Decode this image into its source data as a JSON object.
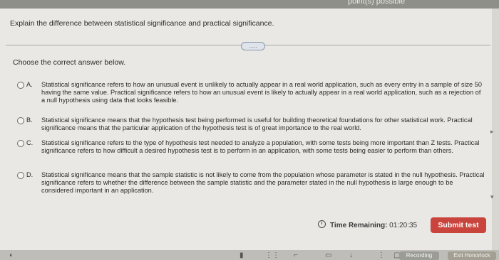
{
  "header": {
    "points_text": "point(s) possible"
  },
  "question": {
    "text": "Explain the difference between statistical significance and practical significance."
  },
  "more_button": {
    "label": "....."
  },
  "prompt": {
    "text": "Choose the correct answer below."
  },
  "options": [
    {
      "letter": "A.",
      "text": "Statistical significance refers to how an unusual event is unlikely to actually appear in a real world application, such as every entry in a sample of size 50 having the same value. Practical significance refers to how an unusual event is likely to actually appear in a real world application, such as a rejection of a null hypothesis using data that looks feasible."
    },
    {
      "letter": "B.",
      "text": "Statistical significance means that the hypothesis test being performed is useful for building theoretical foundations for other statistical work. Practical significance means that the particular application of the hypothesis test is of great importance to the real world."
    },
    {
      "letter": "C.",
      "text": "Statistical significance refers to the type of hypothesis test needed to analyze a population, with some tests being more important than Z tests. Practical significance refers to how difficult a desired hypothesis test is to perform in an application, with some tests being easier to perform than others."
    },
    {
      "letter": "D.",
      "text": "Statistical significance means that the sample statistic is not likely to come from the population whose parameter is stated in the null hypothesis. Practical significance refers to whether the difference between the sample statistic and the parameter stated in the null hypothesis is large enough to be considered important in an application."
    }
  ],
  "timer": {
    "label": "Time Remaining:",
    "value": "01:20:35"
  },
  "submit": {
    "label": "Submit test"
  },
  "bottom_bar": {
    "recording_label": "Recording",
    "exit_label": "Exit Honorlock"
  },
  "colors": {
    "submit": "#c9443c",
    "panel": "#e9e8e4"
  },
  "icons": [
    "clock-icon",
    "radio-icon",
    "arrow-down-icon",
    "scroll-arrow-icon"
  ]
}
